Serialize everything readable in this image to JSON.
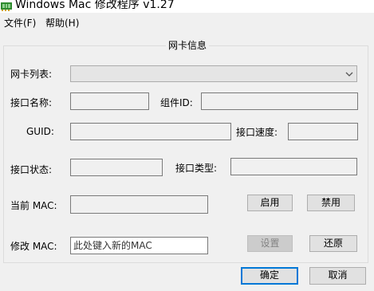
{
  "window": {
    "title": "Windows Mac 修改程序 v1.27"
  },
  "menu": {
    "items": [
      "文件(F)",
      "帮助(H)"
    ]
  },
  "group": {
    "title": "网卡信息"
  },
  "labels": {
    "nic_list": "网卡列表:",
    "iface_name": "接口名称:",
    "component_id": "组件ID:",
    "guid": "GUID:",
    "iface_speed": "接口速度:",
    "iface_status": "接口状态:",
    "iface_type": "接口类型:",
    "current_mac": "当前 MAC:",
    "modify_mac": "修改 MAC:"
  },
  "inputs": {
    "new_mac_placeholder": "此处键入新的MAC"
  },
  "buttons": {
    "enable": "启用",
    "disable": "禁用",
    "set": "设置",
    "restore": "还原",
    "ok": "确定",
    "cancel": "取消"
  },
  "colors": {
    "focus_border": "#0078d7",
    "icon_green": "#2e8b2e"
  }
}
